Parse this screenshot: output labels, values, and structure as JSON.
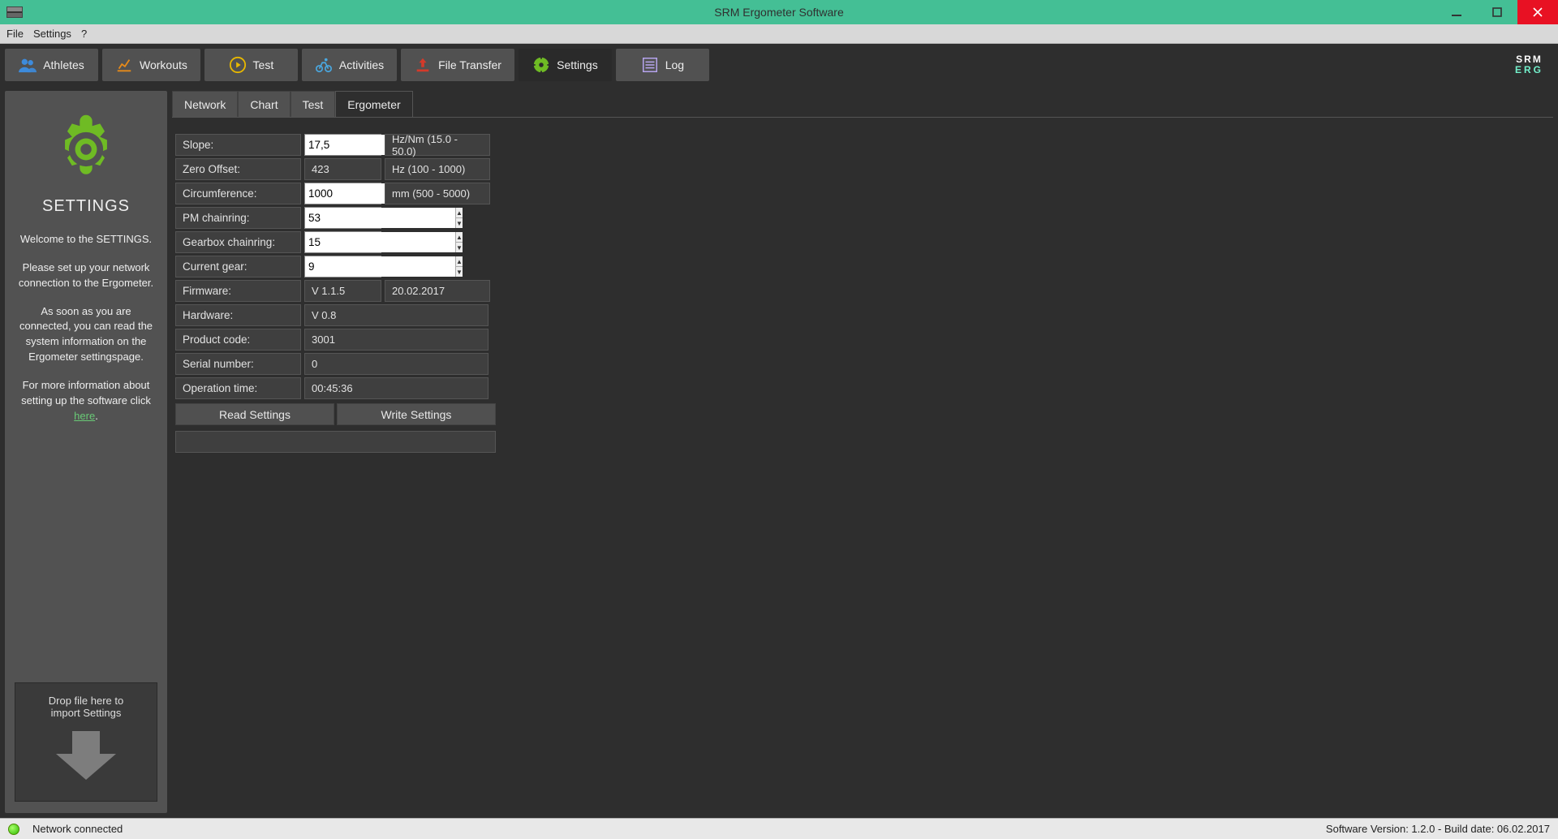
{
  "titlebar": {
    "title": "SRM Ergometer Software"
  },
  "menubar": {
    "file": "File",
    "settings": "Settings",
    "help": "?"
  },
  "ribbon": {
    "athletes": "Athletes",
    "workouts": "Workouts",
    "test": "Test",
    "activities": "Activities",
    "filetransfer": "File Transfer",
    "settings": "Settings",
    "log": "Log"
  },
  "logo": {
    "line1": "SRM",
    "line2": "ERG"
  },
  "sidebar": {
    "title": "SETTINGS",
    "p1": "Welcome to the SETTINGS.",
    "p2": "Please set up your network connection to the Ergometer.",
    "p3": "As soon as you are connected, you can read the system information on the Ergometer settingspage.",
    "p4a": "For more information about setting up the software click ",
    "p4link": "here",
    "p4b": ".",
    "drop1": "Drop file here to",
    "drop2": "import Settings"
  },
  "subtabs": {
    "network": "Network",
    "chart": "Chart",
    "test": "Test",
    "ergometer": "Ergometer"
  },
  "form": {
    "slope": {
      "label": "Slope:",
      "value": "17,5",
      "hint": "Hz/Nm (15.0 - 50.0)"
    },
    "zero": {
      "label": "Zero Offset:",
      "value": "423",
      "hint": "Hz (100 - 1000)"
    },
    "circ": {
      "label": "Circumference:",
      "value": "1000",
      "hint": "mm (500 - 5000)"
    },
    "pm": {
      "label": "PM chainring:",
      "value": "53"
    },
    "gbox": {
      "label": "Gearbox chainring:",
      "value": "15"
    },
    "gear": {
      "label": "Current gear:",
      "value": "9"
    },
    "fw": {
      "label": "Firmware:",
      "value": "V 1.1.5",
      "date": "20.02.2017"
    },
    "hw": {
      "label": "Hardware:",
      "value": "V 0.8"
    },
    "pcode": {
      "label": "Product code:",
      "value": "3001"
    },
    "serial": {
      "label": "Serial number:",
      "value": "0"
    },
    "optime": {
      "label": "Operation time:",
      "value": "00:45:36"
    },
    "read": "Read Settings",
    "write": "Write Settings"
  },
  "statusbar": {
    "left": "Network connected",
    "right": "Software Version: 1.2.0 - Build date: 06.02.2017"
  }
}
